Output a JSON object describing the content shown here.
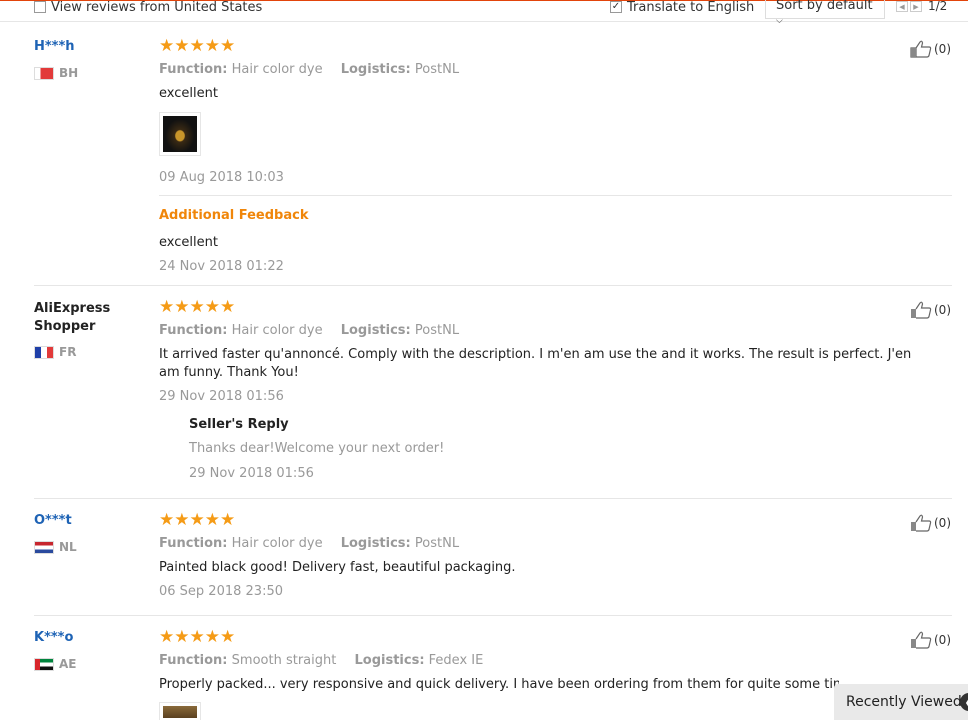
{
  "topbar": {
    "view_us_label": "View reviews from United States",
    "translate_label": "Translate to English",
    "sort_label": "Sort by default",
    "page_indicator": "1/2"
  },
  "labels": {
    "function": "Function:",
    "logistics": "Logistics:",
    "additional_feedback": "Additional Feedback",
    "sellers_reply": "Seller's Reply"
  },
  "reviews": [
    {
      "user": "H***h",
      "country": "BH",
      "stars": "★★★★★",
      "function": "Hair color dye",
      "logistics": "PostNL",
      "text": "excellent",
      "date": "09 Aug 2018 10:03",
      "likes": "(0)",
      "additional_text": "excellent",
      "additional_date": "24 Nov 2018 01:22"
    },
    {
      "user": "AliExpress Shopper",
      "country": "FR",
      "stars": "★★★★★",
      "function": "Hair color dye",
      "logistics": "PostNL",
      "text": "It arrived faster qu'annoncé. Comply with the description. I m'en am use the and it works. The result is perfect. J'en am funny. Thank You!",
      "date": "29 Nov 2018 01:56",
      "likes": "(0)",
      "reply_text": "Thanks dear!Welcome your next order!",
      "reply_date": "29 Nov 2018 01:56"
    },
    {
      "user": "O***t",
      "country": "NL",
      "stars": "★★★★★",
      "function": "Hair color dye",
      "logistics": "PostNL",
      "text": "Painted black good! Delivery fast, beautiful packaging.",
      "date": "06 Sep 2018 23:50",
      "likes": "(0)"
    },
    {
      "user": "K***o",
      "country": "AE",
      "stars": "★★★★★",
      "function": "Smooth straight",
      "logistics": "Fedex IE",
      "text": "Properly packed... very responsive and quick delivery. I have been ordering from them for quite some time. Highl",
      "likes": "(0)"
    }
  ],
  "recently_viewed": "Recently Viewed",
  "colors": {
    "accent_orange": "#f0860a",
    "star": "#f59b16",
    "link_blue": "#1e63b5",
    "top_border": "#e2440b"
  },
  "icons": [
    "thumbs-up-icon",
    "checkbox-icon",
    "chevron-down-icon",
    "prev-page-icon",
    "next-page-icon",
    "arrow-icon"
  ]
}
